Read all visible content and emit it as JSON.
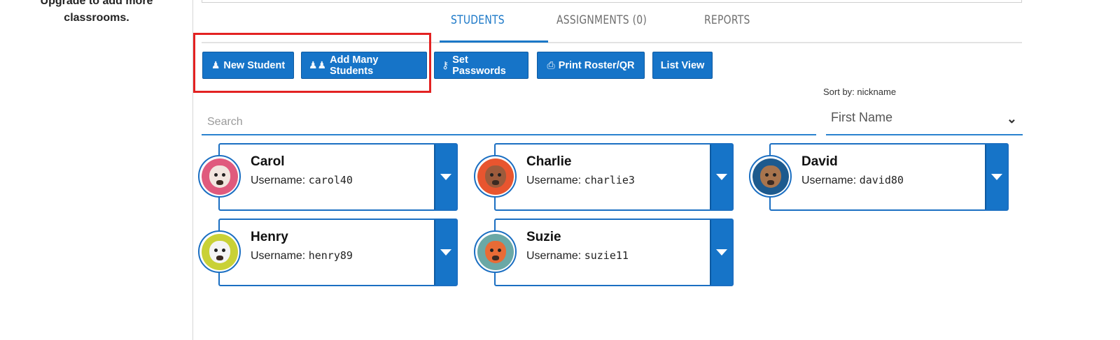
{
  "sidebar": {
    "upgrade_line1": "Upgrade to add more",
    "upgrade_line2": "classrooms."
  },
  "tabs": [
    {
      "label": "STUDENTS",
      "active": true
    },
    {
      "label": "ASSIGNMENTS (0)",
      "active": false
    },
    {
      "label": "REPORTS",
      "active": false
    }
  ],
  "toolbar": {
    "new_student": "New Student",
    "add_many": "Add Many Students",
    "set_passwords": "Set Passwords",
    "print_roster": "Print Roster/QR",
    "list_view": "List View"
  },
  "sort": {
    "label": "Sort by: nickname",
    "selected": "First Name"
  },
  "search": {
    "placeholder": "Search"
  },
  "username_label": "Username:",
  "students": [
    {
      "name": "Carol",
      "username": "carol40",
      "avatar": "cow-avatar-icon",
      "bg": "#e05a7d",
      "face": "#f2e6df"
    },
    {
      "name": "Charlie",
      "username": "charlie3",
      "avatar": "squirrel-avatar-icon",
      "bg": "#e8552f",
      "face": "#9c5b3c"
    },
    {
      "name": "David",
      "username": "david80",
      "avatar": "bear-avatar-icon",
      "bg": "#1d5a8e",
      "face": "#a8744d"
    },
    {
      "name": "Henry",
      "username": "henry89",
      "avatar": "zebra-avatar-icon",
      "bg": "#c9d136",
      "face": "#f4f4f4"
    },
    {
      "name": "Suzie",
      "username": "suzie11",
      "avatar": "fox-avatar-icon",
      "bg": "#6aa8a6",
      "face": "#e86b36"
    }
  ],
  "colors": {
    "accent": "#1674c8",
    "highlight": "#e32222"
  }
}
